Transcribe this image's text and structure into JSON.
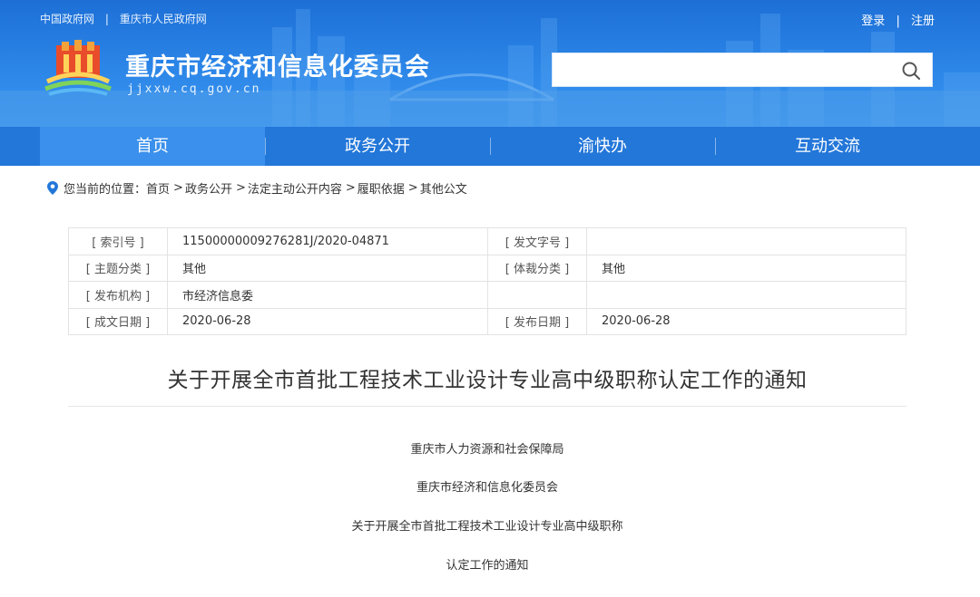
{
  "top_links": [
    "中国政府网",
    "重庆市人民政府网"
  ],
  "user_links": [
    "登录",
    "注册"
  ],
  "site": {
    "title": "重庆市经济和信息化委员会",
    "domain": "jjxxw.cq.gov.cn"
  },
  "search": {
    "placeholder": "",
    "icon": "search-icon"
  },
  "nav": [
    "首页",
    "政务公开",
    "渝快办",
    "互动交流"
  ],
  "breadcrumb": {
    "prefix": "您当前的位置：",
    "items": [
      "首页",
      "政务公开",
      "法定主动公开内容",
      "履职依据",
      "其他公文"
    ],
    "separator": ">"
  },
  "info_table": {
    "rows": [
      {
        "label1": "[ 索引号 ]",
        "value1": "11500000009276281J/2020-04871",
        "label2": "[ 发文字号 ]",
        "value2": ""
      },
      {
        "label1": "[ 主题分类 ]",
        "value1": "其他",
        "label2": "[ 体裁分类 ]",
        "value2": "其他"
      },
      {
        "label1": "[ 发布机构 ]",
        "value1": "市经济信息委",
        "label2": "",
        "value2": ""
      },
      {
        "label1": "[ 成文日期 ]",
        "value1": "2020-06-28",
        "label2": "[ 发布日期 ]",
        "value2": "2020-06-28"
      }
    ]
  },
  "article": {
    "title": "关于开展全市首批工程技术工业设计专业高中级职称认定工作的通知",
    "lines": [
      "重庆市人力资源和社会保障局",
      "重庆市经济和信息化委员会",
      "关于开展全市首批工程技术工业设计专业高中级职称",
      "认定工作的通知"
    ]
  },
  "colors": {
    "header": "#2c86e8",
    "nav": "#2377d9",
    "nav_active": "#3a90ec"
  }
}
